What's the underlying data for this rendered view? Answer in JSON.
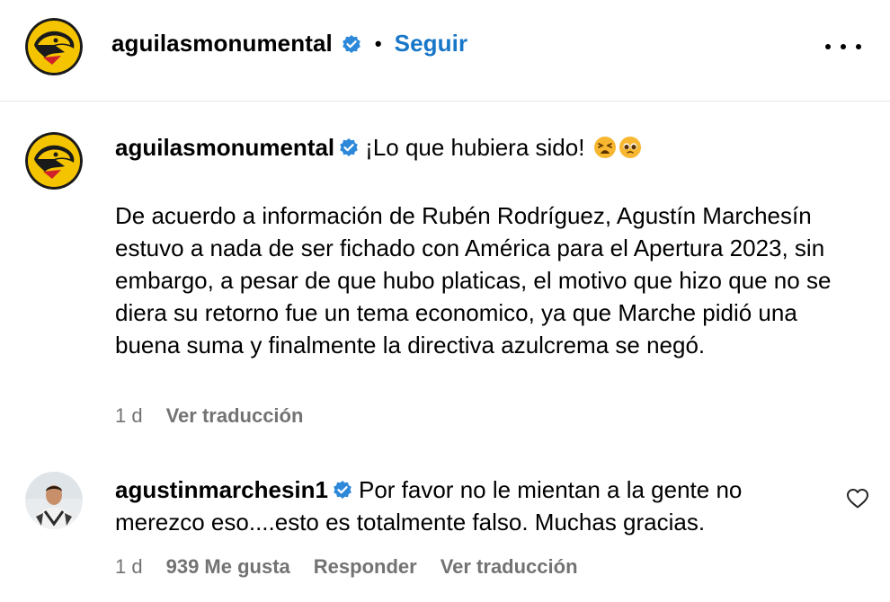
{
  "header": {
    "username": "aguilasmonumental",
    "separator": "•",
    "follow_label": "Seguir"
  },
  "post": {
    "username": "aguilasmonumental",
    "headline": "¡Lo que hubiera sido!",
    "emojis": [
      "tired-face-emoji",
      "pleading-face-emoji"
    ],
    "body": "De acuerdo a información de Rubén Rodríguez, Agustín Marchesín estuvo a nada de ser fichado con América para el Apertura 2023, sin embargo, a pesar de que hubo platicas, el motivo que hizo que no se diera su retorno fue un tema economico, ya que Marche pidió una buena suma y finalmente la directiva azulcrema se negó.",
    "time": "1 d",
    "translate_label": "Ver traducción"
  },
  "comment": {
    "username": "agustinmarchesin1",
    "text": "Por favor no le mientan a la gente no merezco eso....esto es totalmente falso. Muchas gracias.",
    "time": "1 d",
    "likes_label": "939 Me gusta",
    "reply_label": "Responder",
    "translate_label": "Ver traducción"
  },
  "colors": {
    "follow_blue": "#1877c8",
    "verified_blue": "#2d88d9",
    "meta_gray": "#737373",
    "logo_yellow": "#f5c400"
  },
  "icons": [
    "verified-badge-icon",
    "more-options-icon",
    "heart-icon"
  ]
}
